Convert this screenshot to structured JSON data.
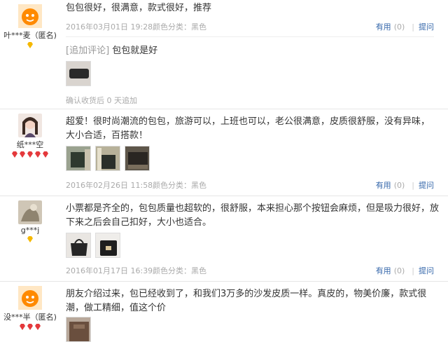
{
  "reviews": [
    {
      "user": "叶***麦（匿名)",
      "text": "包包很好，很满意，款式很好，推荐",
      "date": "2016年03月01日 19:28",
      "sku": "颜色分类：黑色",
      "useful_label": "有用",
      "useful_count": "(0)",
      "ask_label": "提问",
      "append_tag": "[追加评论]",
      "append_text": "包包就是好",
      "after_label": "确认收货后 0 天追加"
    },
    {
      "user": "纸***空",
      "text": "超爱！很时尚潮流的包包，旅游可以，上班也可以，老公很满意，皮质很舒服，没有异味，大小合适，百搭款！",
      "date": "2016年02月26日 11:58",
      "sku": "颜色分类：黑色",
      "useful_label": "有用",
      "useful_count": "(0)",
      "ask_label": "提问"
    },
    {
      "user": "g***j",
      "text": "小票都是齐全的，包包质量也超软的，很舒服，本来担心那个按钮会麻烦，但是吸力很好，放下来之后会自己扣好，大小也适合。",
      "date": "2016年01月17日 16:39",
      "sku": "颜色分类：黑色",
      "useful_label": "有用",
      "useful_count": "(0)",
      "ask_label": "提问"
    },
    {
      "user": "没***半（匿名)",
      "text": "朋友介绍过来，包已经收到了，和我们3万多的沙发皮质一样。真皮的，物美价廉，款式很潮，做工精细，值这个价"
    }
  ],
  "colors": {
    "link": "#3366aa",
    "meta": "#aaaaaa",
    "rank_red": "#e4393c",
    "rank_gold": "#f5b800"
  }
}
